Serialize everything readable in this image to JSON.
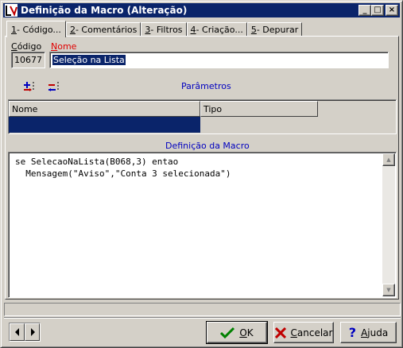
{
  "window": {
    "title": "Definição da Macro (Alteração)",
    "controls": {
      "minimize": "_",
      "maximize": "□",
      "close": "×"
    }
  },
  "tabs": [
    {
      "key": "1",
      "label": " - Código...",
      "active": true
    },
    {
      "key": "2",
      "label": " - Comentários",
      "active": false
    },
    {
      "key": "3",
      "label": " - Filtros",
      "active": false
    },
    {
      "key": "4",
      "label": " - Criação...",
      "active": false
    },
    {
      "key": "5",
      "label": "- Depurar",
      "active": false
    }
  ],
  "form": {
    "codigo_label_key": "C",
    "codigo_label_rest": "ódigo",
    "codigo_value": "10677",
    "nome_label_key": "N",
    "nome_label_rest": "ome",
    "nome_value": "Seleção na Lista"
  },
  "parametros": {
    "title": "Parâmetros",
    "add_icon": "add-parameter-icon",
    "remove_icon": "remove-parameter-icon",
    "columns": [
      "Nome",
      "Tipo"
    ]
  },
  "definicao": {
    "title": "Definição da Macro",
    "code_lines": [
      "se SelecaoNaLista(B068,3) entao",
      "  Mensagem(\"Aviso\",\"Conta 3 selecionada\")"
    ]
  },
  "buttons": {
    "ok_key": "O",
    "ok_rest": "K",
    "cancel_key": "C",
    "cancel_rest": "ancelar",
    "help_key": "A",
    "help_rest": "juda"
  },
  "colors": {
    "title_bar": "#0a246a",
    "selection": "#0a246a",
    "required_label": "#e00000",
    "section_label": "#0000c0"
  }
}
